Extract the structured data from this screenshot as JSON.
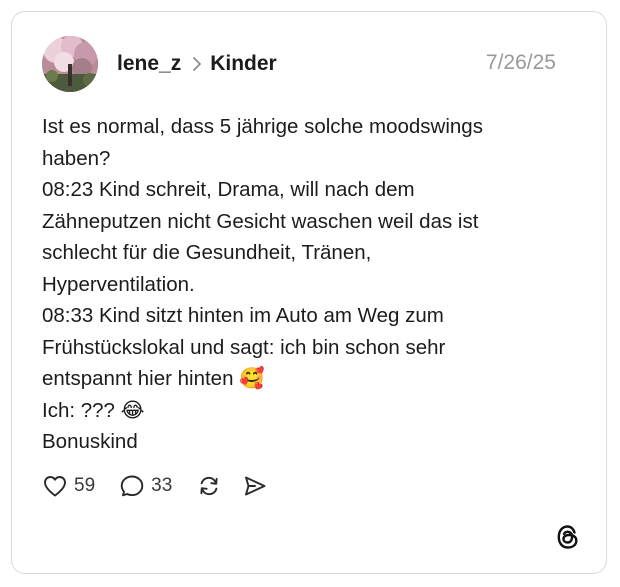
{
  "post": {
    "username": "lene_z",
    "community": "Kinder",
    "date": "7/26/25",
    "lines": [
      "Ist es normal, dass 5 jährige solche moodswings",
      "haben?",
      "08:23 Kind schreit, Drama, will nach dem",
      "Zähneputzen nicht Gesicht waschen weil das ist",
      "schlecht für die Gesundheit, Tränen,",
      "Hyperventilation.",
      "08:33 Kind sitzt hinten im Auto am Weg zum",
      "Frühstückslokal und sagt: ich bin schon sehr",
      "entspannt hier hinten 🥰",
      "Ich: ??? 😂",
      "Bonuskind"
    ]
  },
  "actions": {
    "likes": "59",
    "comments": "33"
  },
  "icons": {
    "avatar": "profile-photo-cherry-blossoms",
    "separator": "chevron-right-icon",
    "like": "heart-icon",
    "comment": "speech-bubble-icon",
    "repost": "repost-icon",
    "share": "send-icon",
    "brand": "threads-logo-icon"
  },
  "colors": {
    "text": "#1c1c1c",
    "muted": "#999999",
    "border": "#d9d9d9"
  }
}
